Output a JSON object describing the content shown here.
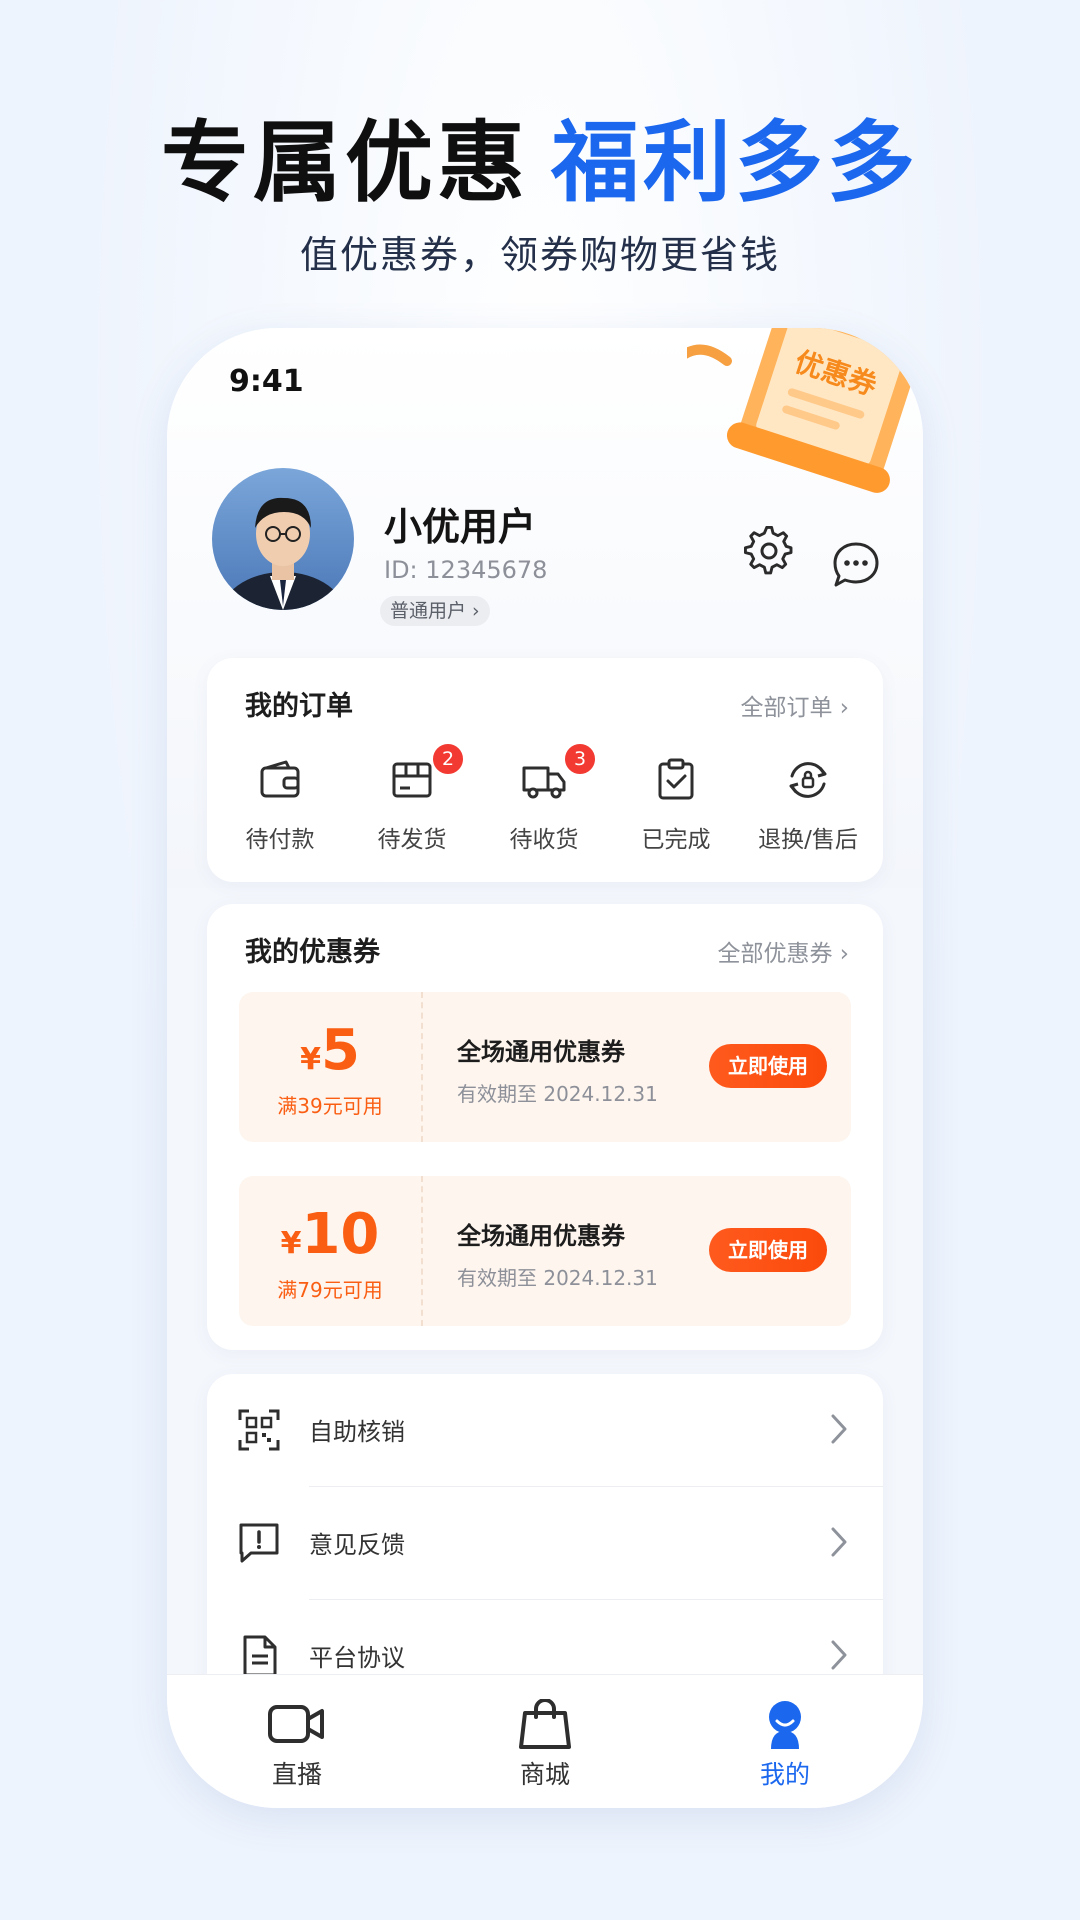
{
  "promo": {
    "headline_dark": "专属优惠",
    "headline_blue": "福利多多",
    "subtitle": "值优惠券，领券购物更省钱"
  },
  "status_bar": {
    "time": "9:41"
  },
  "decoration": {
    "coupon_text": "优惠券"
  },
  "profile": {
    "name": "小优用户",
    "id_text": "ID: 12345678",
    "level": "普通用户 ›"
  },
  "orders": {
    "title": "我的订单",
    "all_link": "全部订单 ›",
    "items": [
      {
        "label": "待付款",
        "icon": "wallet-icon",
        "badge": ""
      },
      {
        "label": "待发货",
        "icon": "package-icon",
        "badge": "2"
      },
      {
        "label": "待收货",
        "icon": "truck-icon",
        "badge": "3"
      },
      {
        "label": "已完成",
        "icon": "clipboard-check-icon",
        "badge": ""
      },
      {
        "label": "退换/售后",
        "icon": "refund-icon",
        "badge": ""
      }
    ]
  },
  "coupons": {
    "title": "我的优惠券",
    "all_link": "全部优惠券 ›",
    "items": [
      {
        "symbol": "¥",
        "amount": "5",
        "condition": "满39元可用",
        "name": "全场通用优惠券",
        "expire": "有效期至  2024.12.31",
        "button": "立即使用"
      },
      {
        "symbol": "¥",
        "amount": "10",
        "condition": "满79元可用",
        "name": "全场通用优惠券",
        "expire": "有效期至  2024.12.31",
        "button": "立即使用"
      }
    ]
  },
  "menu": {
    "items": [
      {
        "label": "自助核销",
        "icon": "qr-scan-icon"
      },
      {
        "label": "意见反馈",
        "icon": "feedback-icon"
      },
      {
        "label": "平台协议",
        "icon": "document-icon"
      }
    ]
  },
  "tabbar": {
    "items": [
      {
        "label": "直播",
        "icon": "video-camera-icon"
      },
      {
        "label": "商城",
        "icon": "shopping-bag-icon"
      },
      {
        "label": "我的",
        "icon": "user-icon"
      }
    ],
    "active_index": 2
  },
  "colors": {
    "accent_blue": "#1b68ef",
    "accent_orange": "#fa5e13",
    "badge_red": "#f23a32"
  }
}
